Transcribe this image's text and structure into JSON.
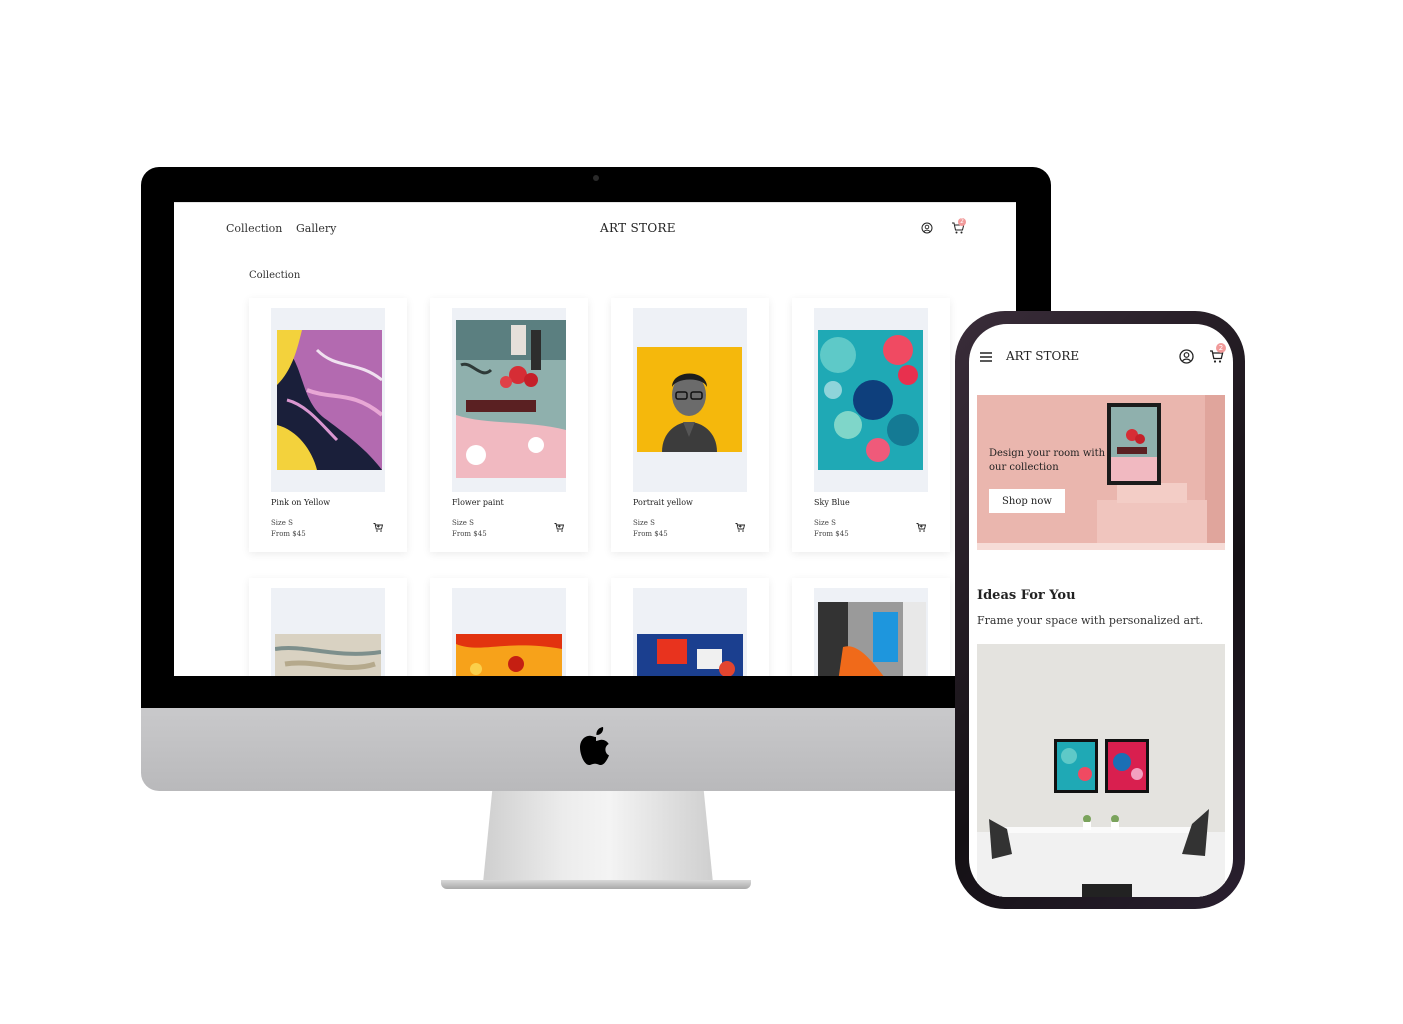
{
  "desktop": {
    "nav": {
      "collection": "Collection",
      "gallery": "Gallery"
    },
    "brand": "ART STORE",
    "cart_count": "2",
    "section_title": "Collection",
    "products": [
      {
        "title": "Pink on Yellow",
        "size": "Size S",
        "price": "From $45"
      },
      {
        "title": "Flower paint",
        "size": "Size S",
        "price": "From $45"
      },
      {
        "title": "Portrait yellow",
        "size": "Size S",
        "price": "From $45"
      },
      {
        "title": "Sky Blue",
        "size": "Size S",
        "price": "From $45"
      }
    ]
  },
  "mobile": {
    "brand": "ART STORE",
    "cart_count": "2",
    "hero": {
      "text": "Design your room with our collection",
      "button": "Shop now"
    },
    "ideas": {
      "title": "Ideas For You",
      "subtitle": "Frame your space with personalized art."
    }
  },
  "icons": {
    "user": "user-circle-icon",
    "cart": "cart-icon",
    "add_to_cart": "cart-plus-icon",
    "menu": "hamburger-icon",
    "apple": "apple-logo"
  },
  "colors": {
    "badge": "#f19a9a",
    "hero_bg": "#eab6ae",
    "card_image_bg": "#eef1f6"
  }
}
